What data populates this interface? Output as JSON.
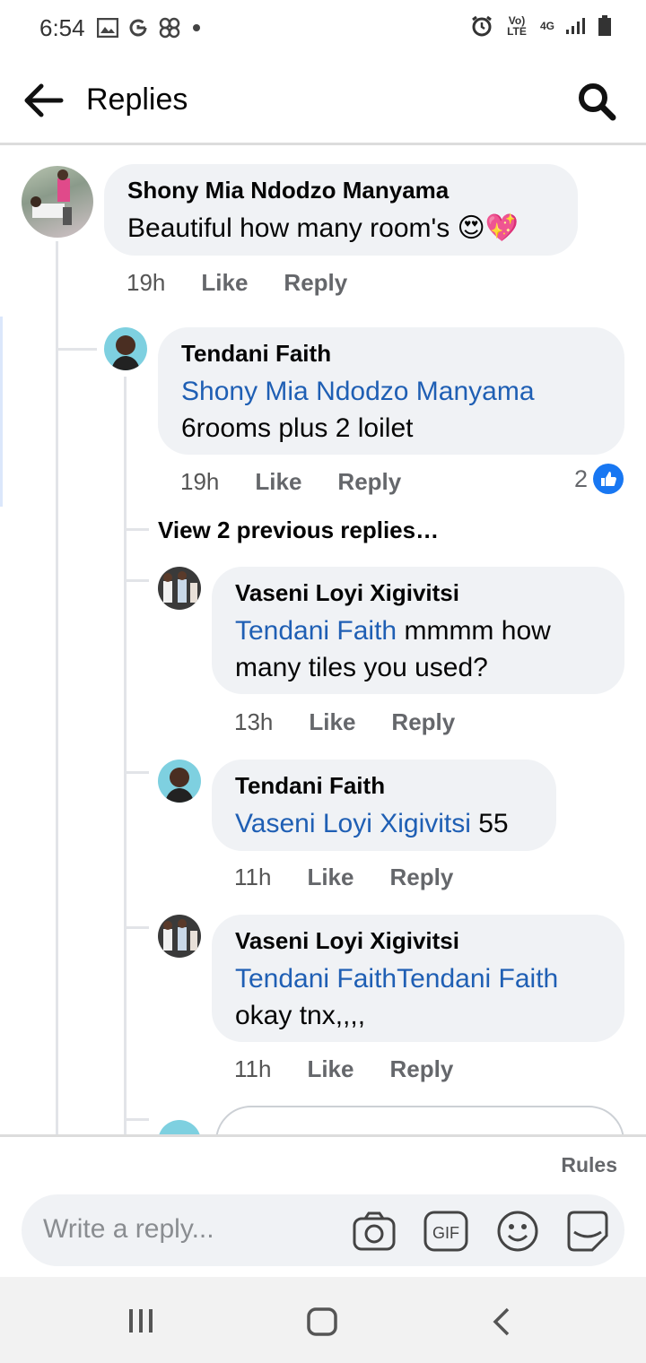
{
  "status": {
    "time": "6:54",
    "left_icons": [
      "image-icon",
      "google-g-icon",
      "pinwheel-icon",
      "dot-icon"
    ],
    "right_icons": [
      "alarm-icon",
      "volte-icon",
      "4g-icon",
      "signal-icon",
      "battery-icon"
    ],
    "volte_text": "Vo) LTE",
    "network_text": "4G"
  },
  "header": {
    "title": "Replies",
    "back_icon": "back-arrow-icon",
    "search_icon": "search-icon"
  },
  "comments": [
    {
      "name": "Shony Mia Ndodzo Manyama",
      "mention": "",
      "text": "Beautiful how many room's 😍💖",
      "time": "19h",
      "like_label": "Like",
      "reply_label": "Reply"
    },
    {
      "name": "Tendani Faith",
      "mention": "Shony Mia Ndodzo Manyama",
      "text": "6rooms plus 2 loilet",
      "time": "19h",
      "like_label": "Like",
      "reply_label": "Reply",
      "reaction_count": "2"
    },
    {
      "name": "Vaseni Loyi Xigivitsi",
      "mention": "Tendani Faith",
      "text": " mmmm how many tiles you used?",
      "time": "13h",
      "like_label": "Like",
      "reply_label": "Reply"
    },
    {
      "name": "Tendani Faith",
      "mention": "Vaseni Loyi Xigivitsi",
      "text": " 55",
      "time": "11h",
      "like_label": "Like",
      "reply_label": "Reply"
    },
    {
      "name": "Vaseni Loyi Xigivitsi",
      "mention": "Tendani FaithTendani Faith",
      "text": "okay tnx,,,,",
      "time": "11h",
      "like_label": "Like",
      "reply_label": "Reply"
    }
  ],
  "view_previous": "View 2 previous replies…",
  "rules_label": "Rules",
  "composer": {
    "placeholder": "Write a reply...",
    "icons": [
      "camera-icon",
      "gif-icon",
      "emoji-icon",
      "sticker-icon"
    ]
  },
  "navbar": [
    "recents-icon",
    "home-icon",
    "back-icon"
  ],
  "colors": {
    "mention": "#1f5fb4",
    "bubble": "#f0f2f5",
    "like_badge": "#1877f2"
  }
}
